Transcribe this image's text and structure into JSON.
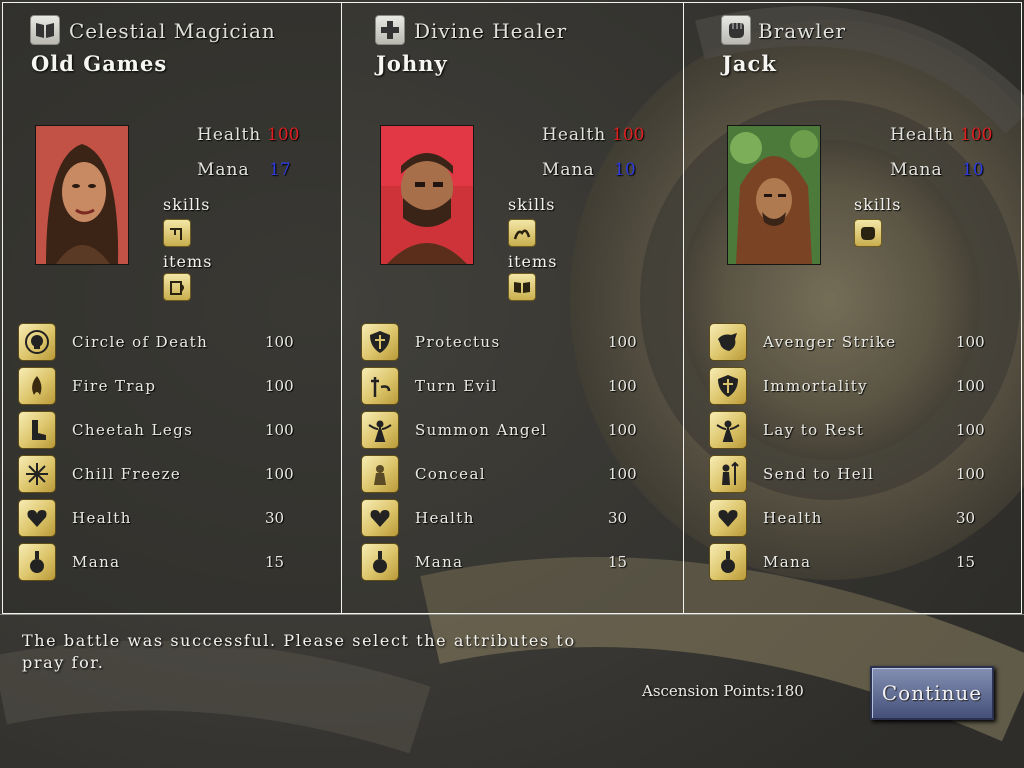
{
  "characters": [
    {
      "class_name": "Celestial Magician",
      "class_icon": "book-icon",
      "name": "Old Games",
      "health_label": "Health",
      "health": "100",
      "mana_label": "Mana",
      "mana": "17",
      "skills_label": "skills",
      "items_label": "items",
      "skill_icon": "lightning-icon",
      "item_icon": "tankard-icon",
      "attributes": [
        {
          "name": "Circle of Death",
          "value": "100",
          "icon": "skull-icon"
        },
        {
          "name": "Fire Trap",
          "value": "100",
          "icon": "fire-icon"
        },
        {
          "name": "Cheetah Legs",
          "value": "100",
          "icon": "boot-icon"
        },
        {
          "name": "Chill Freeze",
          "value": "100",
          "icon": "snowflake-icon"
        },
        {
          "name": "Health",
          "value": "30",
          "icon": "heart-icon"
        },
        {
          "name": "Mana",
          "value": "15",
          "icon": "potion-icon"
        }
      ]
    },
    {
      "class_name": "Divine Healer",
      "class_icon": "cross-icon",
      "name": "Johny",
      "health_label": "Health",
      "health": "100",
      "mana_label": "Mana",
      "mana": "10",
      "skills_label": "skills",
      "items_label": "items",
      "skill_icon": "hands-icon",
      "item_icon": "book-icon",
      "attributes": [
        {
          "name": "Protectus",
          "value": "100",
          "icon": "shield-icon"
        },
        {
          "name": "Turn Evil",
          "value": "100",
          "icon": "cross-staff-icon"
        },
        {
          "name": "Summon Angel",
          "value": "100",
          "icon": "angel-icon"
        },
        {
          "name": "Conceal",
          "value": "100",
          "icon": "ghost-icon"
        },
        {
          "name": "Health",
          "value": "30",
          "icon": "heart-icon"
        },
        {
          "name": "Mana",
          "value": "15",
          "icon": "potion-icon"
        }
      ]
    },
    {
      "class_name": "Brawler",
      "class_icon": "fist-icon",
      "name": "Jack",
      "health_label": "Health",
      "health": "100",
      "mana_label": "Mana",
      "mana": "10",
      "skills_label": "skills",
      "skill_icon": "fist-icon",
      "attributes": [
        {
          "name": "Avenger Strike",
          "value": "100",
          "icon": "strike-icon"
        },
        {
          "name": "Immortality",
          "value": "100",
          "icon": "shield-icon"
        },
        {
          "name": "Lay to Rest",
          "value": "100",
          "icon": "angel-icon"
        },
        {
          "name": "Send to Hell",
          "value": "100",
          "icon": "devil-icon"
        },
        {
          "name": "Health",
          "value": "30",
          "icon": "heart-icon"
        },
        {
          "name": "Mana",
          "value": "15",
          "icon": "potion-icon"
        }
      ]
    }
  ],
  "message": "The battle was successful. Please select the attributes to pray for.",
  "ascension_label": "Ascension Points:",
  "ascension_points": "180",
  "continue_label": "Continue",
  "colors": {
    "health": "#e02020",
    "mana": "#2c3ce0",
    "gold_button": "#dcc46a",
    "continue": "#6470a0"
  }
}
